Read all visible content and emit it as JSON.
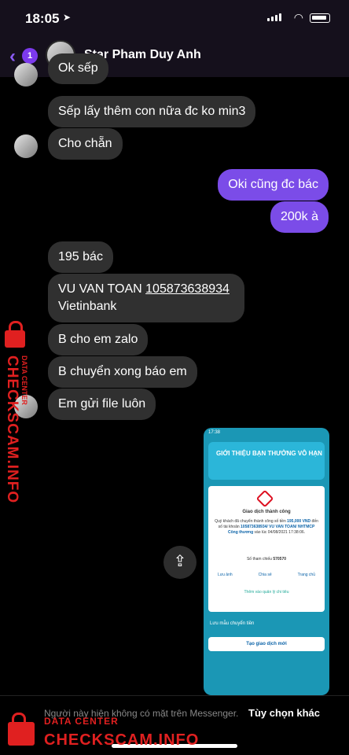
{
  "status": {
    "time": "18:05"
  },
  "header": {
    "back_count": "1",
    "contact_name": "Star Pham Duy Anh"
  },
  "messages": {
    "m0": "Ok sếp",
    "m1": "Sếp lấy thêm con nữa đc ko min3",
    "m2": "Cho chẵn",
    "m3": "Oki cũng đc bác",
    "m4": "200k à",
    "m5": "195 bác",
    "m6a": "VU VAN TOAN ",
    "m6b": "105873638934",
    "m6c": "Vietinbank",
    "m7": "B cho em zalo",
    "m8": "B chuyển xong báo em",
    "m9": "Em gửi file luôn"
  },
  "receipt": {
    "time": "17:38",
    "banner": "GIỚI THIỆU BẠN THƯỞNG VÔ HẠN",
    "title": "Giao dịch thành công",
    "detail1": "Quý khách đã chuyển thành công số tiền",
    "amount": "195,000 VND",
    "detail2": "đến số tài khoản",
    "account": "105873638934/ VU VAN TOAN/ NHTMCP Công thương",
    "detail3": "vào lúc 04/08/2021 17:38:06.",
    "ref_label": "Số tham chiếu",
    "ref_value": "570570",
    "act1": "Lưu ảnh",
    "act2": "Chia sẻ",
    "act3": "Trang chủ",
    "add_label": "Thêm vào quản lý chi tiêu",
    "save_template": "Lưu mẫu chuyển tiền",
    "new_button": "Tạo giao dịch mới"
  },
  "footer": {
    "note": "Người này hiện không có mặt trên Messenger.",
    "options": "Tùy chọn khác"
  },
  "watermark": {
    "line1": "DATA CENTER",
    "line2": "CHECKSCAM.INFO"
  },
  "colors": {
    "outgoing": "#7b4ce8",
    "incoming": "#303030",
    "watermark": "#e02020"
  }
}
